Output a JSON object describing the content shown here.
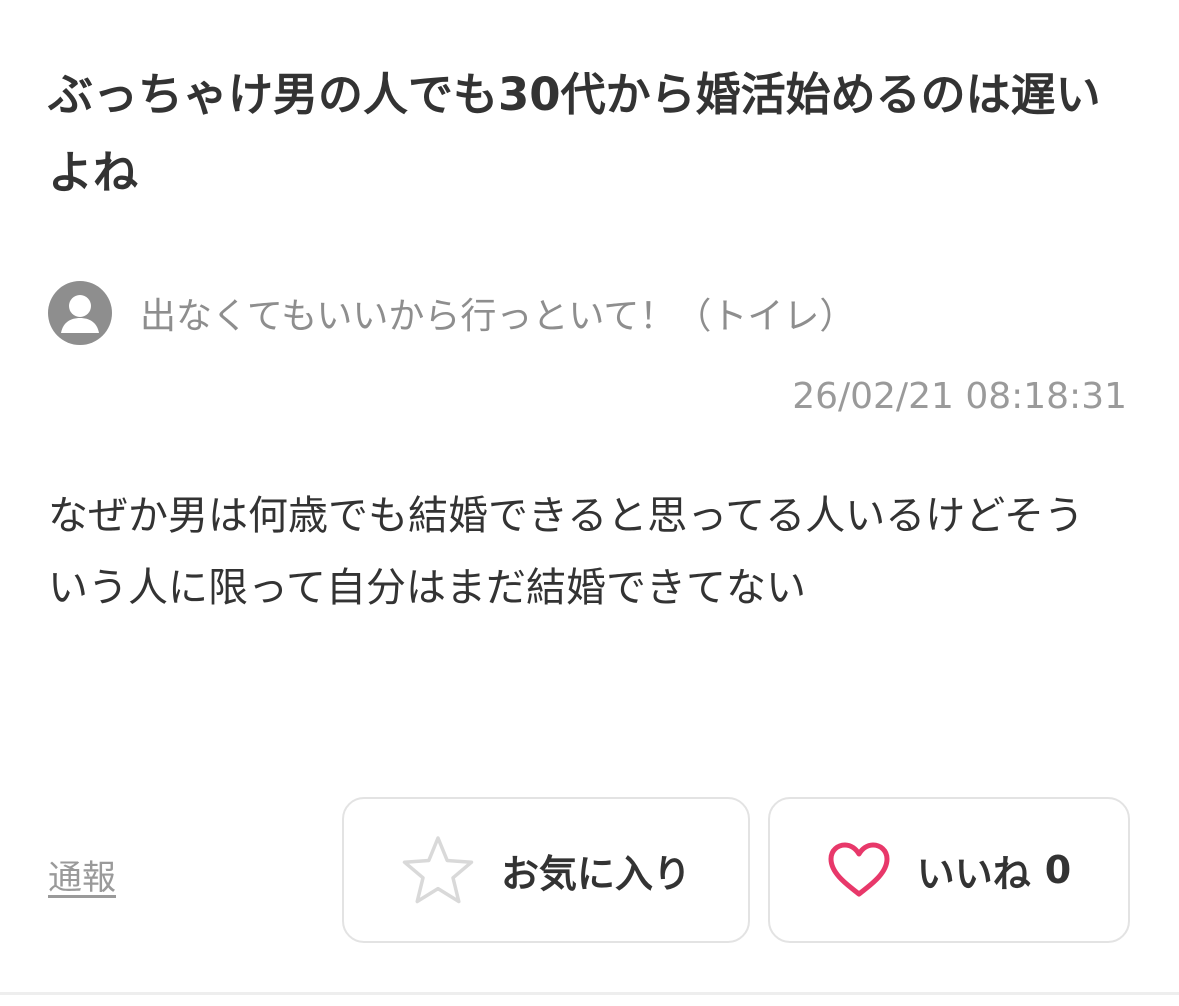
{
  "post": {
    "title": "ぶっちゃけ男の人でも30代から婚活始めるのは遅いよね",
    "author": "出なくてもいいから行っといて！（トイレ）",
    "timestamp": "26/02/21 08:18:31",
    "body": "なぜか男は何歳でも結婚できると思ってる人いるけどそういう人に限って自分はまだ結婚できてない"
  },
  "actions": {
    "report_label": "通報",
    "favorite_label": "お気に入り",
    "like_label": "いいね",
    "like_count": "0"
  },
  "icons": {
    "avatar": "user-avatar-icon",
    "favorite": "star-outline-icon",
    "like": "heart-outline-icon"
  },
  "colors": {
    "text": "#333333",
    "muted": "#8e8e8e",
    "like_accent": "#e8386a",
    "star_outline": "#d9d9d9",
    "button_border": "#e3e3e3"
  }
}
